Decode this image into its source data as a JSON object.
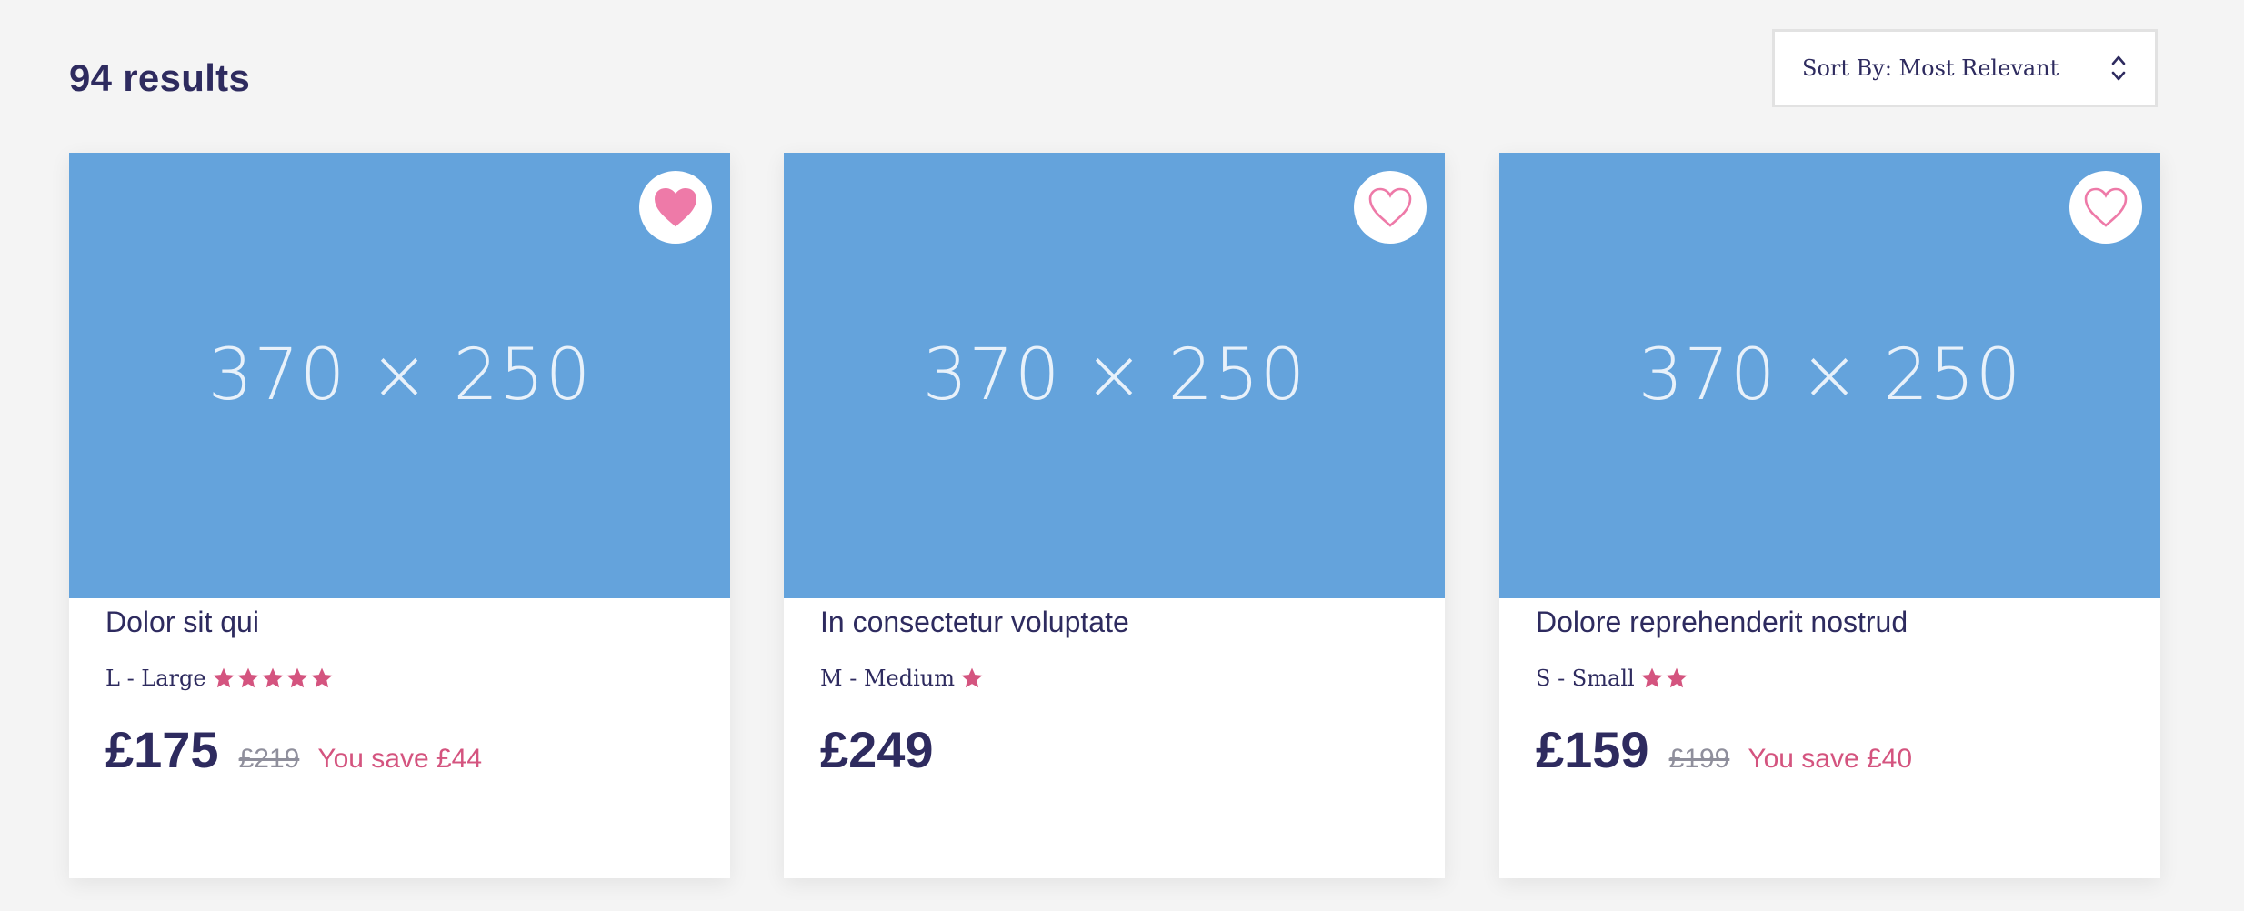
{
  "header": {
    "results_count": "94 results"
  },
  "sort": {
    "label": "Sort By: Most Relevant"
  },
  "colors": {
    "accent_pink": "#d4547f",
    "heart_pink": "#ee7aa8",
    "navy_text": "#2e2b5f",
    "image_blue": "#64a3dc",
    "background": "#f4f4f4"
  },
  "products": [
    {
      "image_text": "370 × 250",
      "favorited": true,
      "title": "Dolor sit qui",
      "size": "L - Large",
      "rating": 5,
      "price": "£175",
      "old_price": "£219",
      "saving": "You save £44"
    },
    {
      "image_text": "370 × 250",
      "favorited": false,
      "title": "In consectetur voluptate",
      "size": "M - Medium",
      "rating": 1,
      "price": "£249",
      "old_price": "",
      "saving": ""
    },
    {
      "image_text": "370 × 250",
      "favorited": false,
      "title": "Dolore reprehenderit nostrud",
      "size": "S - Small",
      "rating": 2,
      "price": "£159",
      "old_price": "£199",
      "saving": "You save £40"
    }
  ]
}
